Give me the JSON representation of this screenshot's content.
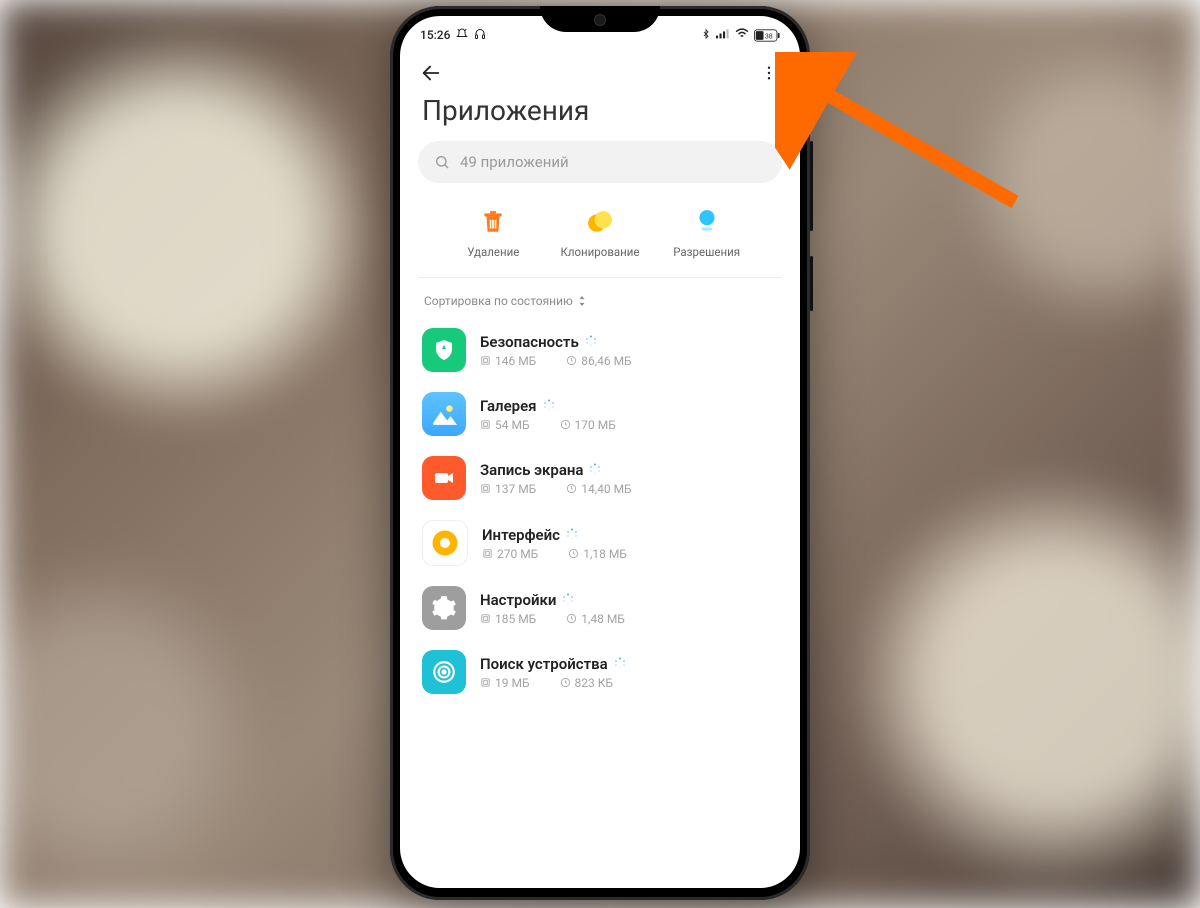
{
  "statusbar": {
    "time": "15:26",
    "battery_text": "38"
  },
  "header": {
    "title": "Приложения"
  },
  "search": {
    "placeholder": "49 приложений"
  },
  "quick": [
    {
      "label": "Удаление",
      "icon": "trash",
      "color": "#ff7a1a"
    },
    {
      "label": "Клонирование",
      "icon": "clone",
      "color": "#ffce3d"
    },
    {
      "label": "Разрешения",
      "icon": "permissions",
      "color": "#2ec5ff"
    }
  ],
  "sort": {
    "label": "Сортировка по состоянию"
  },
  "apps": [
    {
      "name": "Безопасность",
      "storage": "146 МБ",
      "data": "86,46 МБ",
      "icon": "shield",
      "bg": "#17c97a"
    },
    {
      "name": "Галерея",
      "storage": "54 МБ",
      "data": "170 МБ",
      "icon": "gallery",
      "bg": "#3bb3ff"
    },
    {
      "name": "Запись экрана",
      "storage": "137 МБ",
      "data": "14,40 МБ",
      "icon": "record",
      "bg": "#ff5a2c"
    },
    {
      "name": "Интерфейс",
      "storage": "270 МБ",
      "data": "1,18 МБ",
      "icon": "circle",
      "bg": "#ffb400"
    },
    {
      "name": "Настройки",
      "storage": "185 МБ",
      "data": "1,48 МБ",
      "icon": "gear",
      "bg": "#9e9e9e"
    },
    {
      "name": "Поиск устройства",
      "storage": "19 МБ",
      "data": "823 КБ",
      "icon": "target",
      "bg": "#1fc1d6"
    }
  ]
}
